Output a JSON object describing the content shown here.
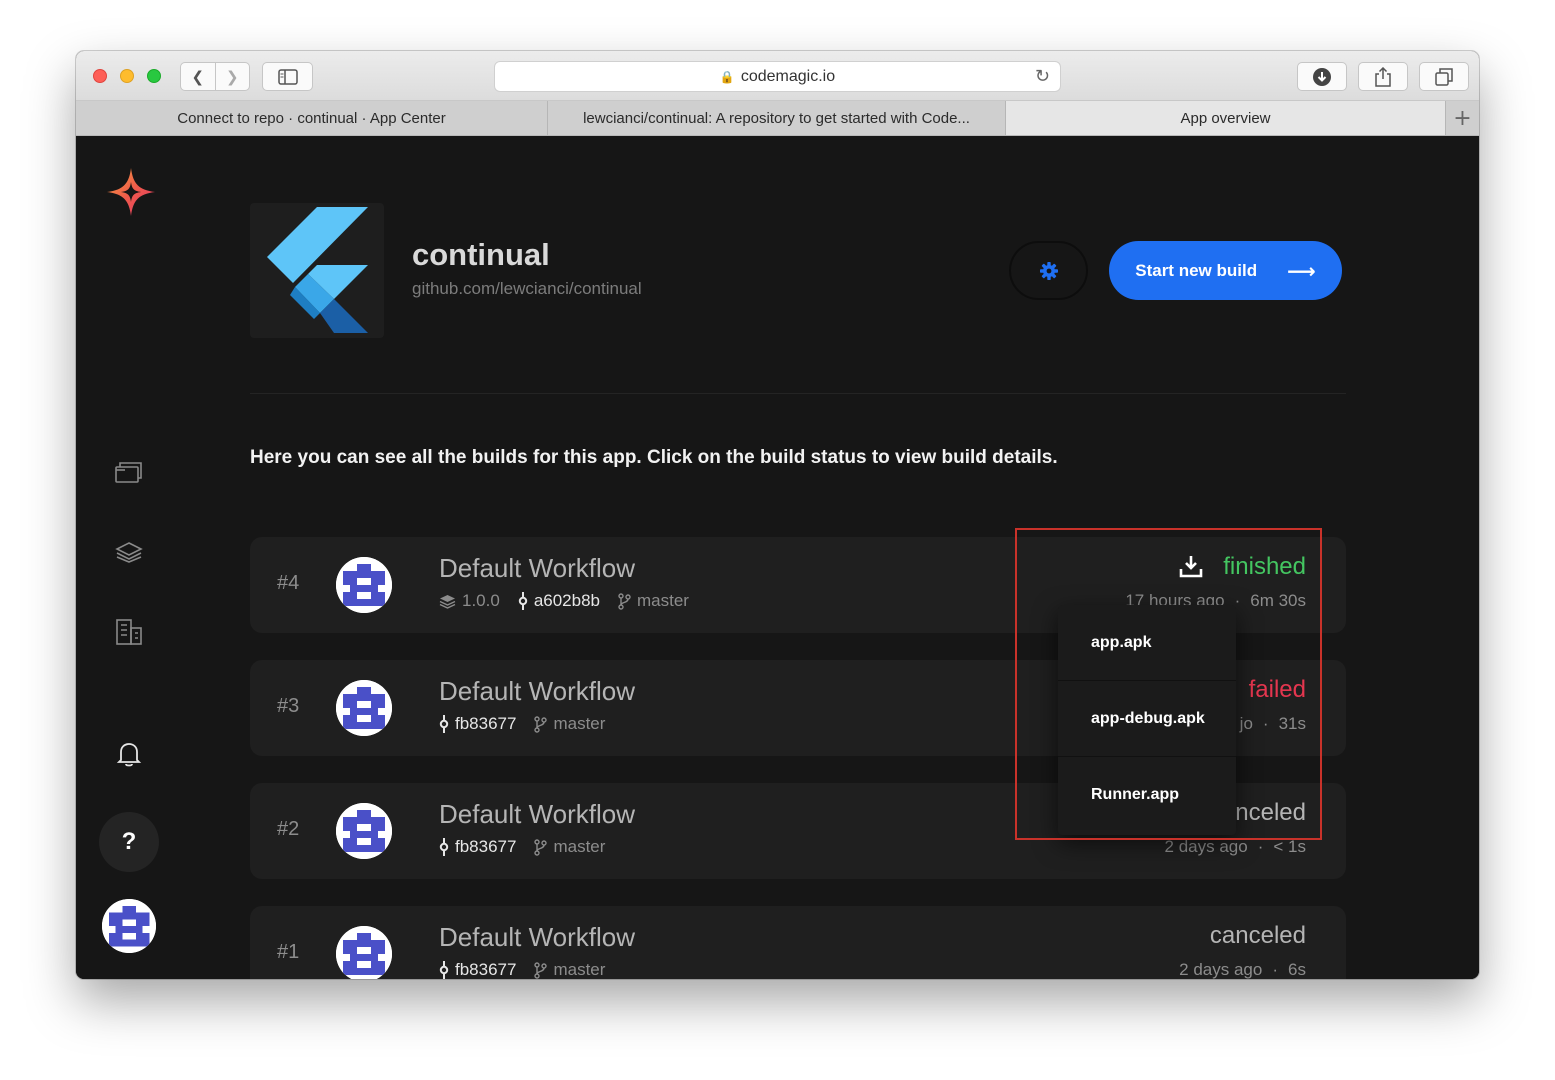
{
  "browser": {
    "url": "codemagic.io",
    "tabs": [
      {
        "label": "Connect to repo · continual · App Center",
        "active": false
      },
      {
        "label": "lewcianci/continual: A repository to get started with Code...",
        "active": false
      },
      {
        "label": "App overview",
        "active": true
      }
    ],
    "new_tab": "+"
  },
  "app": {
    "name": "continual",
    "repo": "github.com/lewcianci/continual",
    "start_build_label": "Start new build",
    "intro_text": "Here you can see all the builds for this app. Click on the build status to view build details.",
    "help_label": "?"
  },
  "builds": [
    {
      "number": "#4",
      "workflow": "Default Workflow",
      "version": "1.0.0",
      "commit": "a602b8b",
      "branch": "master",
      "status": "finished",
      "ago": "17 hours ago",
      "sep": "·",
      "duration": "6m 30s"
    },
    {
      "number": "#3",
      "workflow": "Default Workflow",
      "commit": "fb83677",
      "branch": "master",
      "status": "failed",
      "ago": "jo",
      "sep": "·",
      "duration": "31s"
    },
    {
      "number": "#2",
      "workflow": "Default Workflow",
      "commit": "fb83677",
      "branch": "master",
      "status": "nceled",
      "ago": "2 days ago",
      "sep": "·",
      "duration": "< 1s"
    },
    {
      "number": "#1",
      "workflow": "Default Workflow",
      "commit": "fb83677",
      "branch": "master",
      "status": "canceled",
      "ago": "2 days ago",
      "sep": "·",
      "duration": "6s"
    }
  ],
  "artifacts_menu": {
    "items": [
      "app.apk",
      "app-debug.apk",
      "Runner.app"
    ]
  },
  "colors": {
    "accent": "#1f6ff2",
    "finished": "#44c661",
    "failed": "#e5364f",
    "highlight": "#c9322a"
  },
  "icons": [
    "codemagic-logo-icon",
    "apps-icon",
    "layers-icon",
    "teams-icon",
    "bell-icon",
    "gear-icon",
    "arrow-right-icon",
    "version-icon",
    "commit-icon",
    "branch-icon",
    "download-icon"
  ]
}
